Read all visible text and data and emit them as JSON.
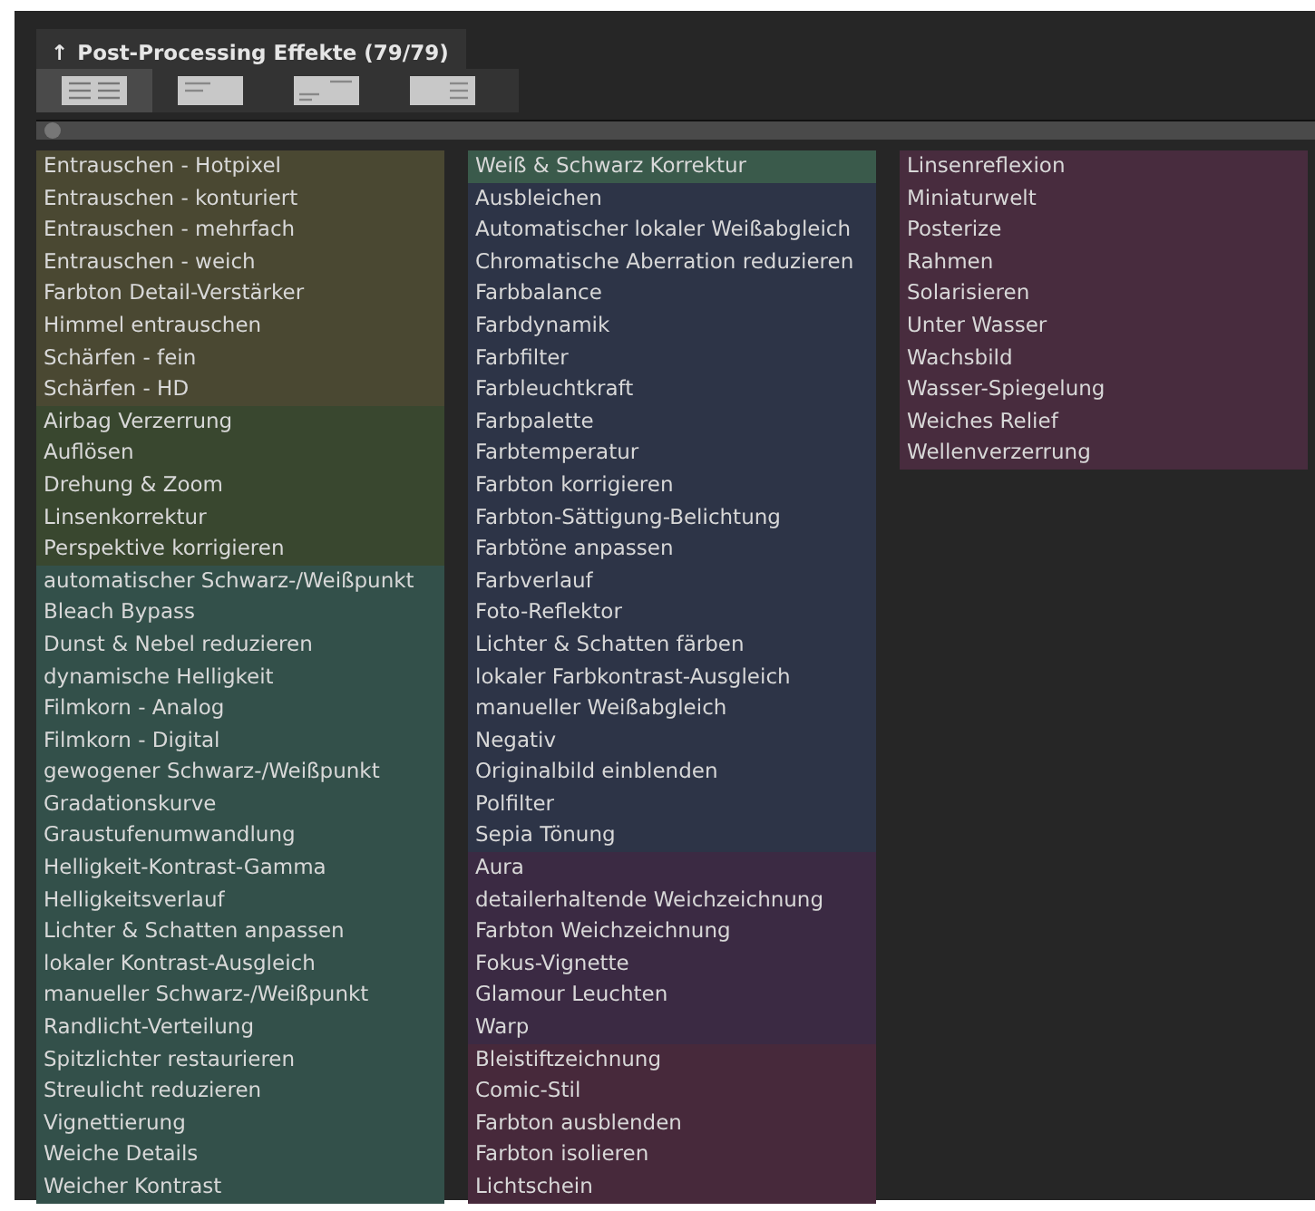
{
  "panel": {
    "title": "Post-Processing Effekte (79/79)",
    "arrow": "↑"
  },
  "view_buttons": [
    {
      "kind": "two-columns",
      "selected": true
    },
    {
      "kind": "left",
      "selected": false
    },
    {
      "kind": "split",
      "selected": false
    },
    {
      "kind": "right",
      "selected": false
    }
  ],
  "columns": [
    [
      {
        "color": "#4a4832",
        "items": [
          "Entrauschen - Hotpixel",
          "Entrauschen - konturiert",
          "Entrauschen - mehrfach",
          "Entrauschen - weich",
          "Farbton Detail-Verstärker",
          "Himmel entrauschen",
          "Schärfen - fein",
          "Schärfen - HD"
        ]
      },
      {
        "color": "#39472f",
        "items": [
          "Airbag Verzerrung",
          "Auflösen",
          "Drehung & Zoom",
          "Linsenkorrektur",
          "Perspektive korrigieren"
        ]
      },
      {
        "color": "#33504a",
        "items": [
          "automatischer Schwarz-/Weißpunkt",
          "Bleach Bypass",
          "Dunst & Nebel reduzieren",
          "dynamische Helligkeit",
          "Filmkorn - Analog",
          "Filmkorn - Digital",
          "gewogener Schwarz-/Weißpunkt",
          "Gradationskurve",
          "Graustufenumwandlung",
          "Helligkeit-Kontrast-Gamma",
          "Helligkeitsverlauf",
          "Lichter & Schatten anpassen",
          "lokaler Kontrast-Ausgleich",
          "manueller Schwarz-/Weißpunkt",
          "Randlicht-Verteilung",
          "Spitzlichter restaurieren",
          "Streulicht reduzieren",
          "Vignettierung",
          "Weiche Details",
          "Weicher Kontrast"
        ]
      }
    ],
    [
      {
        "color": "#3a5a4b",
        "items": [
          "Weiß & Schwarz Korrektur"
        ]
      },
      {
        "color": "#2d3447",
        "items": [
          "Ausbleichen",
          "Automatischer lokaler Weißabgleich",
          "Chromatische Aberration reduzieren",
          "Farbbalance",
          "Farbdynamik",
          "Farbfilter",
          "Farbleuchtkraft",
          "Farbpalette",
          "Farbtemperatur",
          "Farbton korrigieren",
          "Farbton-Sättigung-Belichtung",
          "Farbtöne anpassen",
          "Farbverlauf",
          "Foto-Reflektor",
          "Lichter & Schatten färben",
          "lokaler Farbkontrast-Ausgleich",
          "manueller Weißabgleich",
          "Negativ",
          "Originalbild einblenden",
          "Polfilter",
          "Sepia Tönung"
        ]
      },
      {
        "color": "#3b2a43",
        "items": [
          "Aura",
          "detailerhaltende Weichzeichnung",
          "Farbton Weichzeichnung",
          "Fokus-Vignette",
          "Glamour Leuchten",
          "Warp"
        ]
      },
      {
        "color": "#47293b",
        "items": [
          "Bleistiftzeichnung",
          "Comic-Stil",
          "Farbton ausblenden",
          "Farbton isolieren",
          "Lichtschein"
        ]
      }
    ],
    [
      {
        "color": "#482c3e",
        "items": [
          "Linsenreflexion",
          "Miniaturwelt",
          "Posterize",
          "Rahmen",
          "Solarisieren",
          "Unter Wasser",
          "Wachsbild",
          "Wasser-Spiegelung",
          "Weiches Relief",
          "Wellenverzerrung"
        ]
      }
    ]
  ]
}
